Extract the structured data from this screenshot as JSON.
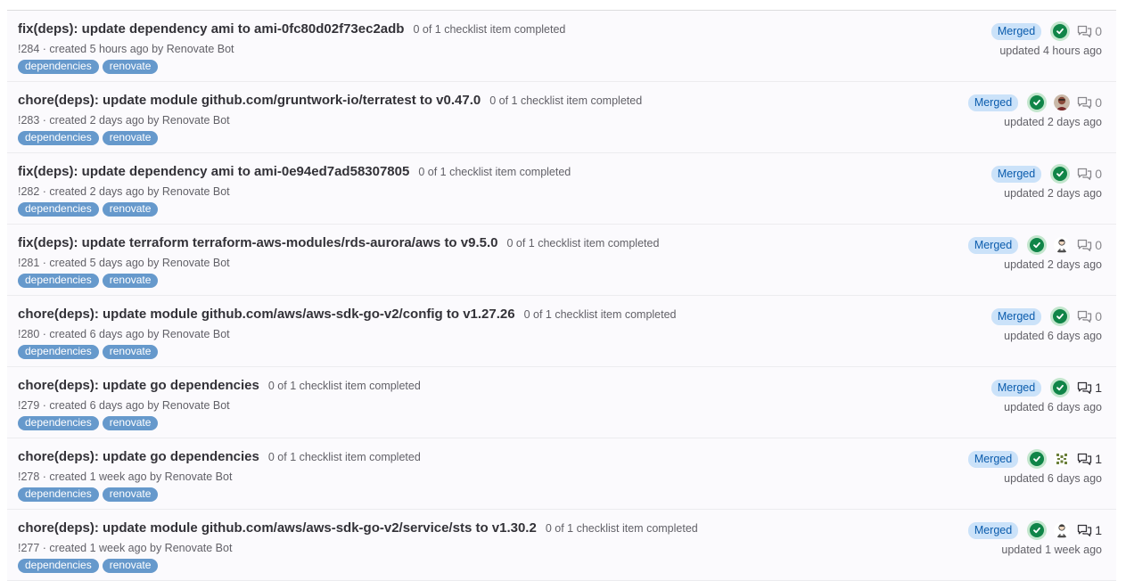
{
  "merge_requests": [
    {
      "title": "fix(deps): update dependency ami to ami-0fc80d02f73ec2adb",
      "checklist": "0 of 1 checklist item completed",
      "meta": "!284 · created 5 hours ago by Renovate Bot",
      "labels": [
        "dependencies",
        "renovate"
      ],
      "status": "Merged",
      "assignee": "none",
      "comments": "0",
      "updated": "updated 4 hours ago"
    },
    {
      "title": "chore(deps): update module github.com/gruntwork-io/terratest to v0.47.0",
      "checklist": "0 of 1 checklist item completed",
      "meta": "!283 · created 2 days ago by Renovate Bot",
      "labels": [
        "dependencies",
        "renovate"
      ],
      "status": "Merged",
      "assignee": "photo-avatar",
      "comments": "0",
      "updated": "updated 2 days ago"
    },
    {
      "title": "fix(deps): update dependency ami to ami-0e94ed7ad58307805",
      "checklist": "0 of 1 checklist item completed",
      "meta": "!282 · created 2 days ago by Renovate Bot",
      "labels": [
        "dependencies",
        "renovate"
      ],
      "status": "Merged",
      "assignee": "none",
      "comments": "0",
      "updated": "updated 2 days ago"
    },
    {
      "title": "fix(deps): update terraform terraform-aws-modules/rds-aurora/aws to v9.5.0",
      "checklist": "0 of 1 checklist item completed",
      "meta": "!281 · created 5 days ago by Renovate Bot",
      "labels": [
        "dependencies",
        "renovate"
      ],
      "status": "Merged",
      "assignee": "illustrated-avatar",
      "comments": "0",
      "updated": "updated 2 days ago"
    },
    {
      "title": "chore(deps): update module github.com/aws/aws-sdk-go-v2/config to v1.27.26",
      "checklist": "0 of 1 checklist item completed",
      "meta": "!280 · created 6 days ago by Renovate Bot",
      "labels": [
        "dependencies",
        "renovate"
      ],
      "status": "Merged",
      "assignee": "none",
      "comments": "0",
      "updated": "updated 6 days ago"
    },
    {
      "title": "chore(deps): update go dependencies",
      "checklist": "0 of 1 checklist item completed",
      "meta": "!279 · created 6 days ago by Renovate Bot",
      "labels": [
        "dependencies",
        "renovate"
      ],
      "status": "Merged",
      "assignee": "none",
      "comments": "1",
      "updated": "updated 6 days ago"
    },
    {
      "title": "chore(deps): update go dependencies",
      "checklist": "0 of 1 checklist item completed",
      "meta": "!278 · created 1 week ago by Renovate Bot",
      "labels": [
        "dependencies",
        "renovate"
      ],
      "status": "Merged",
      "assignee": "identicon-avatar",
      "comments": "1",
      "updated": "updated 6 days ago"
    },
    {
      "title": "chore(deps): update module github.com/aws/aws-sdk-go-v2/service/sts to v1.30.2",
      "checklist": "0 of 1 checklist item completed",
      "meta": "!277 · created 1 week ago by Renovate Bot",
      "labels": [
        "dependencies",
        "renovate"
      ],
      "status": "Merged",
      "assignee": "illustrated-avatar",
      "comments": "1",
      "updated": "updated 1 week ago"
    }
  ],
  "colors": {
    "label_bg": "#6699cc",
    "merged_badge_bg": "#cbe2f9",
    "merged_badge_text": "#0b5cad",
    "pipeline_success": "#108548"
  },
  "icons": {
    "pipeline": "check-circle-icon",
    "comments": "comments-icon"
  }
}
